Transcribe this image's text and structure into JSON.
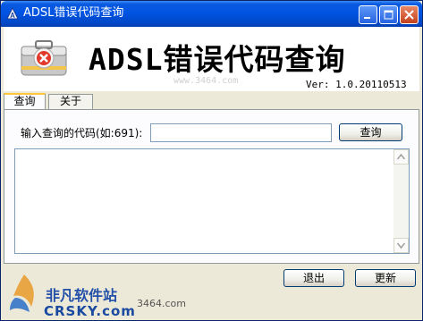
{
  "window": {
    "title": "ADSL错误代码查询"
  },
  "header": {
    "big_title": "ADSL错误代码查询",
    "web_mark": "www.3464.com",
    "version": "Ver: 1.0.20110513"
  },
  "tabs": [
    {
      "label": "查询",
      "active": true
    },
    {
      "label": "关于",
      "active": false
    }
  ],
  "query": {
    "label": "输入查询的代码(如:691):",
    "input_value": "",
    "button": "查询"
  },
  "result": {
    "text": ""
  },
  "footer": {
    "exit_button": "退出",
    "update_button": "更新"
  },
  "watermark": {
    "chinese": "非凡软件站",
    "english": "CRSKY.com",
    "domain": "3464.com"
  },
  "icons": {
    "app": "adsl-app-icon",
    "logo": "toolbox-error-icon",
    "minimize": "minimize-icon",
    "maximize": "maximize-icon",
    "close": "close-icon",
    "scroll_up": "scroll-up-arrow-icon",
    "scroll_down": "scroll-down-arrow-icon"
  },
  "colors": {
    "titlebar": "#0054e3",
    "window_bg": "#ece9d8",
    "tab_active_accent": "#ffc83c"
  }
}
